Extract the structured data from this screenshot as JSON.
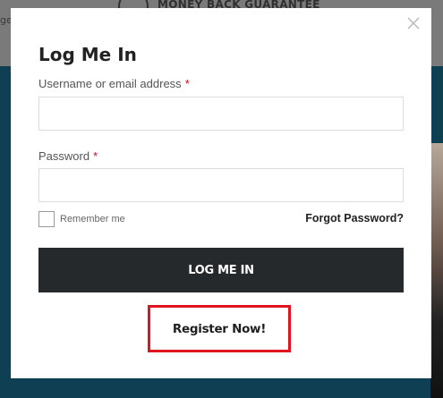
{
  "background": {
    "banner_text": "MONEY BACK GUARANTEE",
    "edge_text": "ge"
  },
  "modal": {
    "close_icon": "close-icon",
    "title": "Log Me In",
    "username": {
      "label": "Username or email address",
      "required_mark": "*",
      "value": "",
      "placeholder": ""
    },
    "password": {
      "label": "Password",
      "required_mark": "*",
      "value": "",
      "placeholder": ""
    },
    "remember_me": {
      "label": "Remember me",
      "checked": false
    },
    "forgot_password": "Forgot Password?",
    "login_button": "LOG ME IN",
    "register_link": "Register Now!"
  },
  "colors": {
    "primary_button": "#26292c",
    "required": "#d0021b",
    "highlight_border": "#e0141e",
    "overlay_bg": "#0e3f53"
  }
}
